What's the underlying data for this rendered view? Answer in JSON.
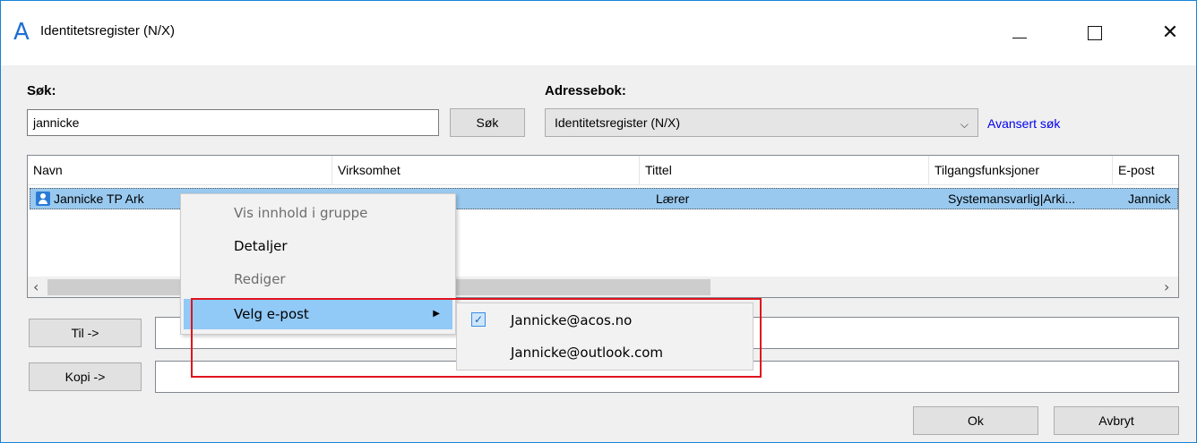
{
  "window": {
    "title": "Identitetsregister (N/X)",
    "icon": "A",
    "minimize_glyph": "",
    "close_glyph": "✕"
  },
  "search": {
    "label": "Søk:",
    "value": "jannicke",
    "button_label": "Søk"
  },
  "addressbook": {
    "label": "Adressebok:",
    "selected": "Identitetsregister (N/X)",
    "advanced_link": "Avansert søk"
  },
  "table": {
    "columns": [
      "Navn",
      "Virksomhet",
      "Tittel",
      "Tilgangsfunksjoner",
      "E-post"
    ],
    "rows": [
      {
        "navn": "Jannicke TP Ark",
        "virksomhet": "",
        "tittel": "Lærer",
        "tilgang": "Systemansvarlig|Arki...",
        "epost": "Jannick"
      }
    ]
  },
  "context_menu": {
    "items": [
      {
        "label": "Vis innhold i gruppe",
        "enabled": false
      },
      {
        "label": "Detaljer",
        "enabled": true
      },
      {
        "label": "Rediger",
        "enabled": false
      },
      {
        "label": "Velg e-post",
        "enabled": true,
        "submenu_arrow": "▶"
      }
    ]
  },
  "submenu": {
    "items": [
      {
        "label": "Jannicke@acos.no",
        "checked": true,
        "check_glyph": "✓"
      },
      {
        "label": "Jannicke@outlook.com",
        "checked": false
      }
    ]
  },
  "recipients": {
    "to_button": "Til ->",
    "to_value": "",
    "cc_button": "Kopi ->",
    "cc_value": ""
  },
  "footer": {
    "ok_label": "Ok",
    "cancel_label": "Avbryt"
  },
  "colors": {
    "selection": "#99c9ef",
    "menu_hot": "#91c9f7",
    "highlight_border": "#e0141e",
    "link": "#0000ee",
    "window_border": "#1883d7"
  }
}
